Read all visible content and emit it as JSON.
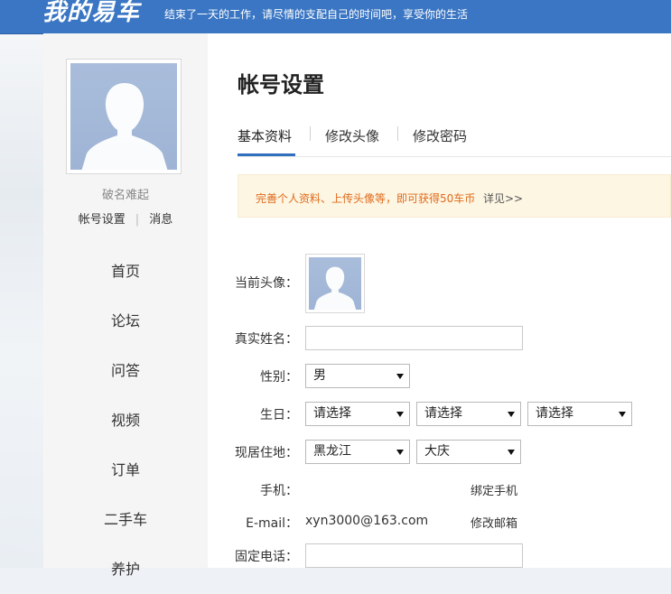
{
  "header": {
    "logo": "我的易车",
    "slogan": "结束了一天的工作，请尽情的支配自己的时间吧，享受你的生活"
  },
  "sidebar": {
    "username": "破名难起",
    "links": [
      "帐号设置",
      "消息"
    ],
    "nav": [
      "首页",
      "论坛",
      "问答",
      "视频",
      "订单",
      "二手车",
      "养护"
    ]
  },
  "main": {
    "title": "帐号设置",
    "tabs": [
      "基本资料",
      "修改头像",
      "修改密码"
    ],
    "notice": {
      "text": "完善个人资料、上传头像等，即可获得50车币",
      "link": "详见>>"
    },
    "form": {
      "avatar_label": "当前头像：",
      "realname_label": "真实姓名：",
      "realname_value": "",
      "gender_label": "性别：",
      "gender_value": "男",
      "birthday_label": "生日：",
      "birthday_year": "请选择",
      "birthday_month": "请选择",
      "birthday_day": "请选择",
      "residence_label": "现居住地：",
      "province": "黑龙江",
      "city": "大庆",
      "phone_label": "手机：",
      "phone_action": "绑定手机",
      "email_label": "E-mail：",
      "email_value": "xyn3000@163.com",
      "email_action": "修改邮箱",
      "landline_label": "固定电话：",
      "landline_value": ""
    }
  },
  "colors": {
    "header_bg": "#3a76c3",
    "accent": "#2f6fbd",
    "notice_text": "#e06a1b",
    "notice_bg": "#fdf6e3"
  }
}
